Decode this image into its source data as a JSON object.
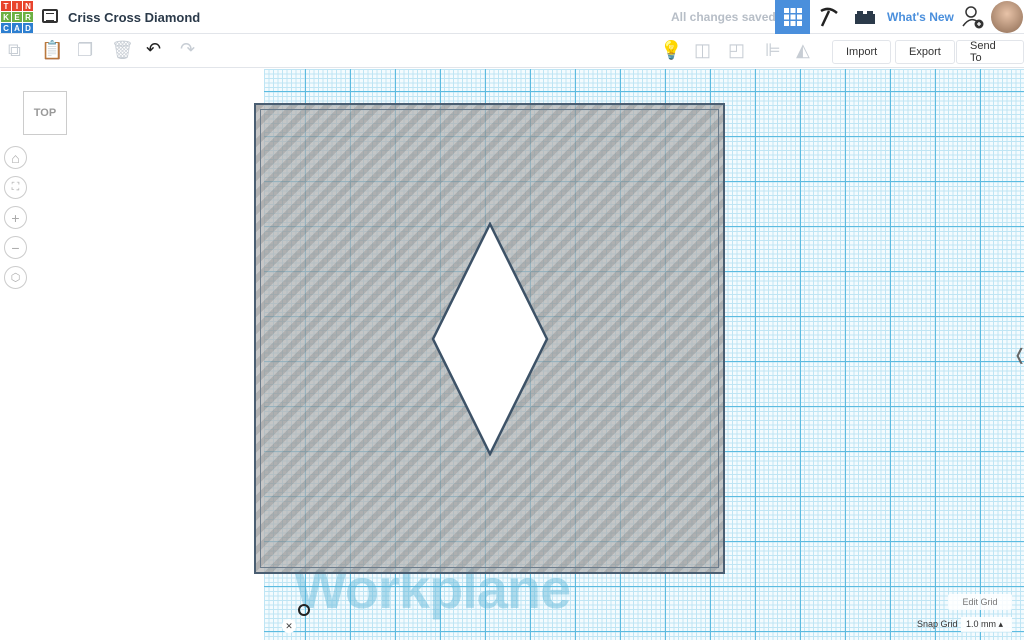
{
  "logo": {
    "letters": [
      "T",
      "I",
      "N",
      "K",
      "E",
      "R",
      "C",
      "A",
      "D"
    ],
    "colors": [
      "#e8442d",
      "#e8442d",
      "#e8442d",
      "#6cb043",
      "#6cb043",
      "#6cb043",
      "#2d7fd0",
      "#2d7fd0",
      "#2d7fd0"
    ]
  },
  "header": {
    "title": "Criss Cross Diamond",
    "status": "All changes saved",
    "whats_new": "What's New"
  },
  "toolbar": {
    "import": "Import",
    "export": "Export",
    "send_to": "Send To"
  },
  "viewcube": {
    "label": "TOP"
  },
  "workplane": {
    "label": "Workplane",
    "edit_grid": "Edit Grid",
    "snap_grid_label": "Snap Grid",
    "snap_grid_value": "1.0 mm ▴"
  }
}
